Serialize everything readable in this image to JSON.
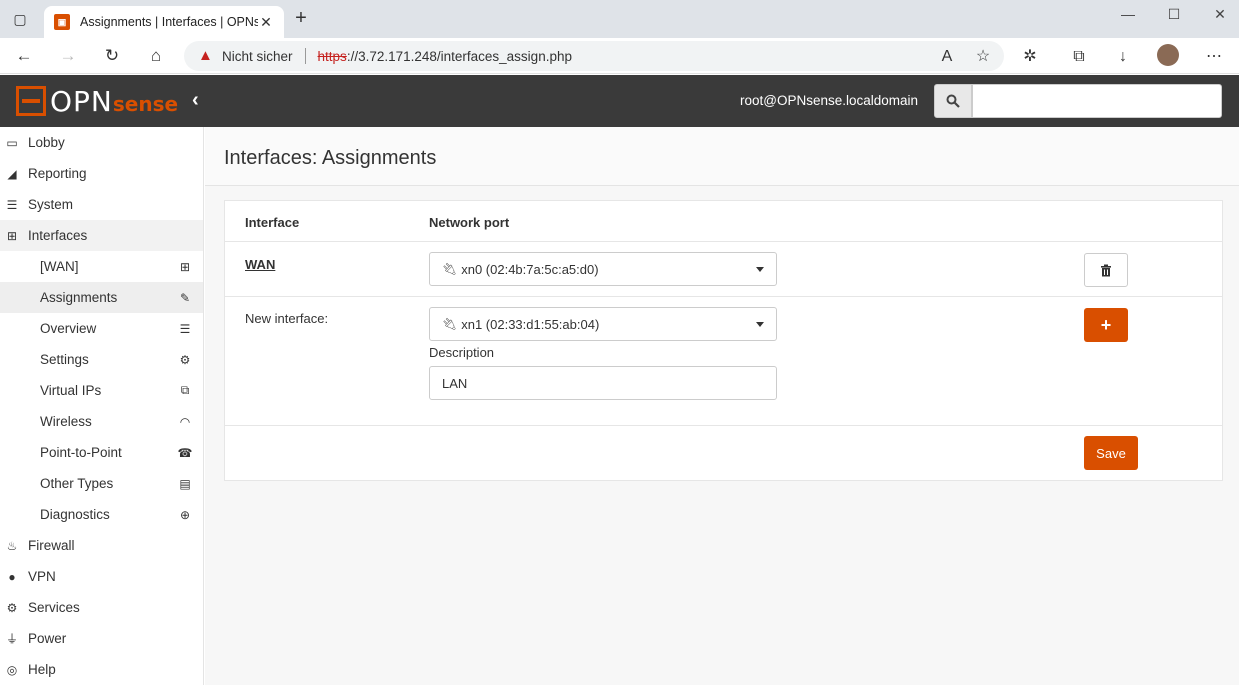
{
  "browser": {
    "tab_title": "Assignments | Interfaces | OPNse",
    "url_warning": "Nicht sicher",
    "url_scheme": "https",
    "url_rest": "://3.72.171.248/interfaces_assign.php"
  },
  "header": {
    "logo_opn": "OPN",
    "logo_sense": "sense",
    "user": "root@OPNsense.localdomain",
    "search_placeholder": ""
  },
  "sidebar": {
    "items": [
      {
        "label": "Lobby",
        "icon": "laptop-icon"
      },
      {
        "label": "Reporting",
        "icon": "area-chart-icon"
      },
      {
        "label": "System",
        "icon": "server-icon"
      },
      {
        "label": "Interfaces",
        "icon": "sitemap-icon"
      }
    ],
    "interfaces_sub": [
      {
        "label": "[WAN]",
        "icon": "sitemap-icon"
      },
      {
        "label": "Assignments",
        "icon": "pencil-icon"
      },
      {
        "label": "Overview",
        "icon": "tasks-icon"
      },
      {
        "label": "Settings",
        "icon": "cogs-icon"
      },
      {
        "label": "Virtual IPs",
        "icon": "clone-icon"
      },
      {
        "label": "Wireless",
        "icon": "wifi-icon"
      },
      {
        "label": "Point-to-Point",
        "icon": "tty-icon"
      },
      {
        "label": "Other Types",
        "icon": "archive-icon"
      },
      {
        "label": "Diagnostics",
        "icon": "medkit-icon"
      }
    ],
    "items_after": [
      {
        "label": "Firewall",
        "icon": "fire-icon"
      },
      {
        "label": "VPN",
        "icon": "globe-icon"
      },
      {
        "label": "Services",
        "icon": "cog-icon"
      },
      {
        "label": "Power",
        "icon": "plug-icon"
      },
      {
        "label": "Help",
        "icon": "support-icon"
      }
    ]
  },
  "main": {
    "title": "Interfaces: Assignments",
    "col_interface": "Interface",
    "col_port": "Network port",
    "wan": {
      "name": "WAN",
      "port": "xn0 (02:4b:7a:5c:a5:d0)"
    },
    "new_interface": {
      "label": "New interface:",
      "port": "xn1 (02:33:d1:55:ab:04)",
      "description_label": "Description",
      "description_value": "LAN"
    },
    "save_label": "Save",
    "add_label": "+"
  },
  "colors": {
    "accent": "#d94f00",
    "header_bg": "#3a3a3a"
  }
}
